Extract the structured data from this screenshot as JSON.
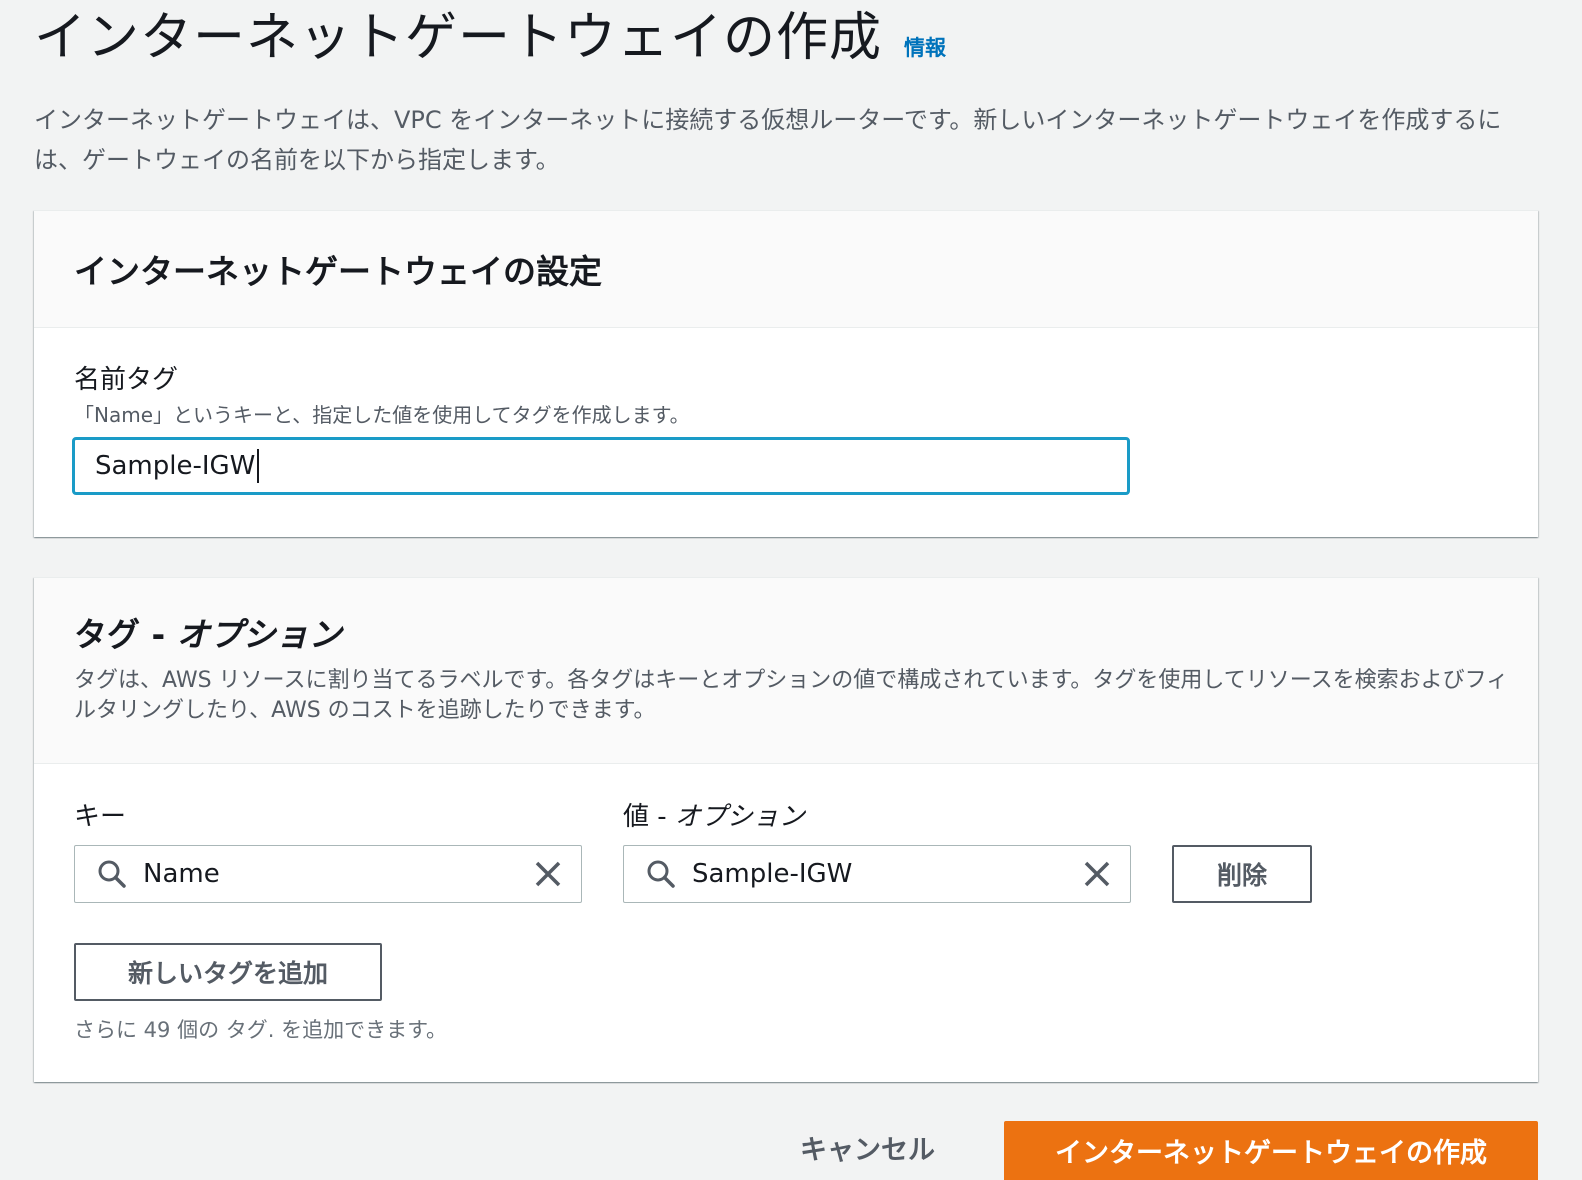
{
  "header": {
    "title": "インターネットゲートウェイの作成",
    "info_link": "情報",
    "description": "インターネットゲートウェイは、VPC をインターネットに接続する仮想ルーターです。新しいインターネットゲートウェイを作成するには、ゲートウェイの名前を以下から指定します。"
  },
  "settings_panel": {
    "title": "インターネットゲートウェイの設定",
    "name_tag": {
      "label": "名前タグ",
      "description": "「Name」というキーと、指定した値を使用してタグを作成します。",
      "value": "Sample-IGW"
    }
  },
  "tags_panel": {
    "title_main": "タグ - ",
    "title_optional": "オプション",
    "description": "タグは、AWS リソースに割り当てるラベルです。各タグはキーとオプションの値で構成されています。タグを使用してリソースを検索およびフィルタリングしたり、AWS のコストを追跡したりできます。",
    "key_label": "キー",
    "value_label_main": "値 - ",
    "value_label_optional": "オプション",
    "tags": [
      {
        "key": "Name",
        "value": "Sample-IGW"
      }
    ],
    "remove_button": "削除",
    "add_button": "新しいタグを追加",
    "remaining_note": "さらに 49 個の タグ. を追加できます。"
  },
  "footer": {
    "cancel_button": "キャンセル",
    "create_button": "インターネットゲートウェイの作成"
  },
  "colors": {
    "accent": "#ec7211",
    "link": "#0073bb",
    "focus_border": "#1a9bc7"
  }
}
